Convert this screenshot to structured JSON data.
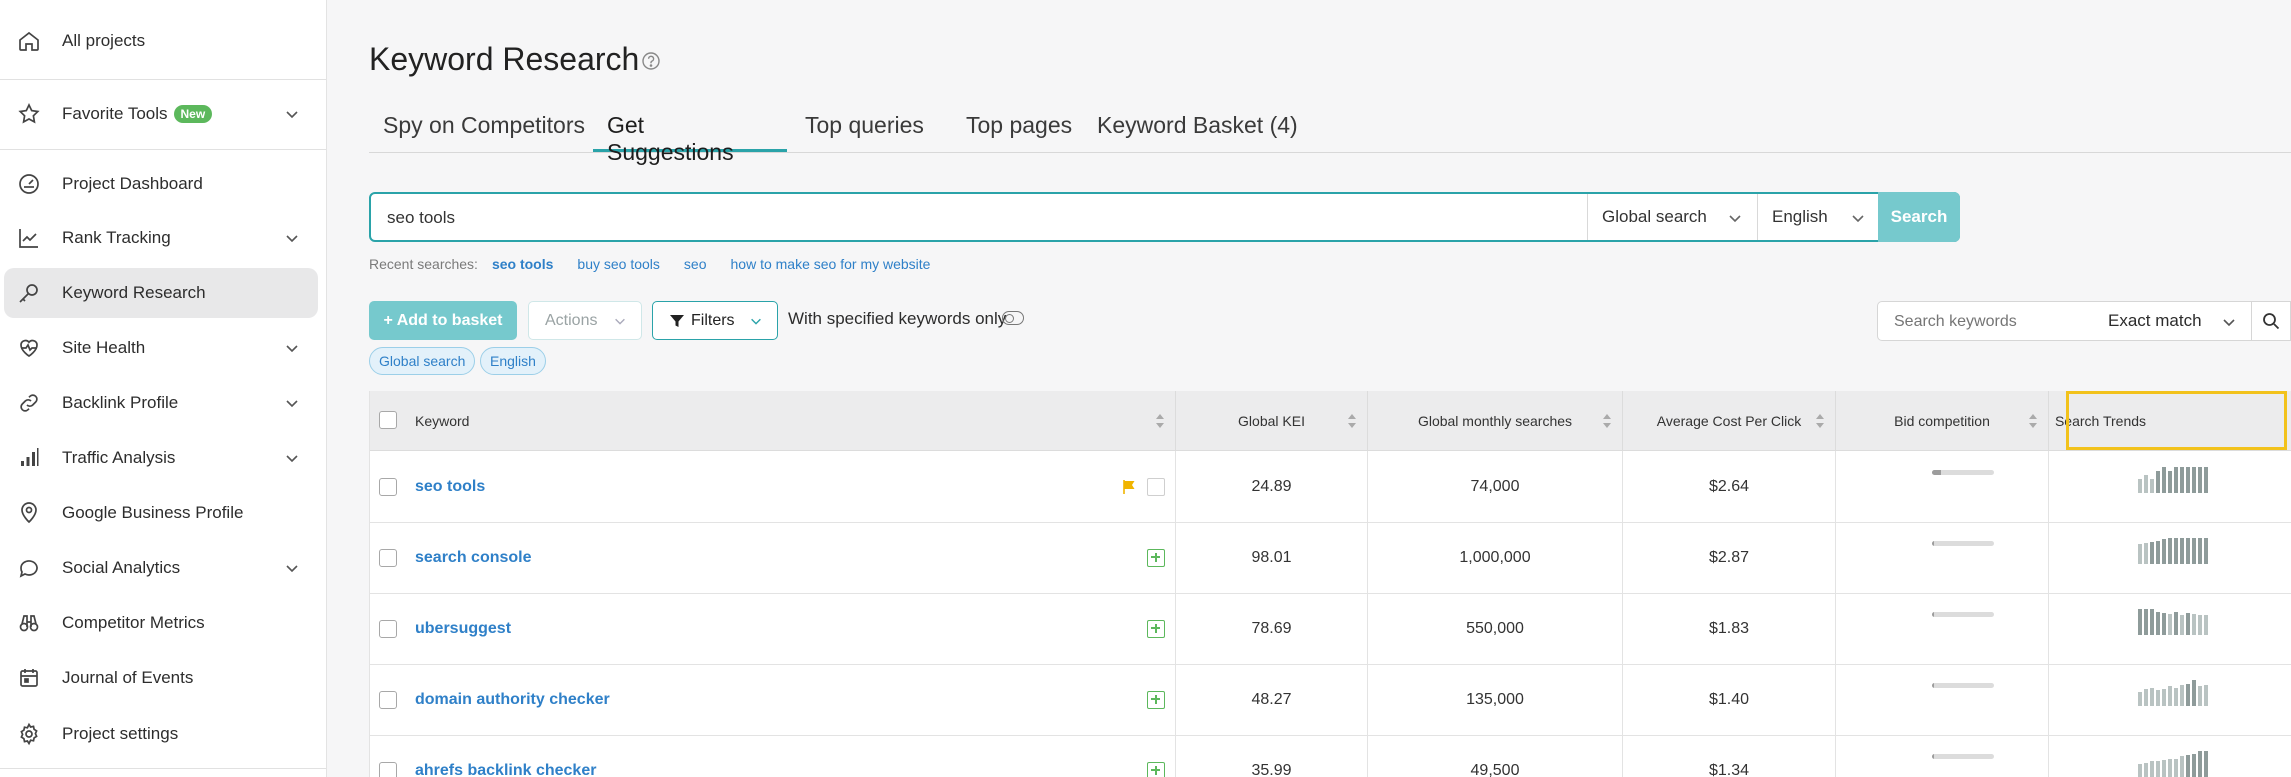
{
  "sidebar": {
    "items": [
      {
        "label": "All projects",
        "icon": "home-icon"
      },
      {
        "label": "Favorite Tools",
        "icon": "star-icon",
        "badge": "New"
      },
      {
        "label": "Project Dashboard",
        "icon": "dashboard-icon"
      },
      {
        "label": "Rank Tracking",
        "icon": "chart-line-icon"
      },
      {
        "label": "Keyword Research",
        "icon": "key-icon"
      },
      {
        "label": "Site Health",
        "icon": "heart-pulse-icon"
      },
      {
        "label": "Backlink Profile",
        "icon": "link-icon"
      },
      {
        "label": "Traffic Analysis",
        "icon": "bars-icon"
      },
      {
        "label": "Google Business Profile",
        "icon": "location-pin-icon"
      },
      {
        "label": "Social Analytics",
        "icon": "chat-bubble-icon"
      },
      {
        "label": "Competitor Metrics",
        "icon": "binoculars-icon"
      },
      {
        "label": "Journal of Events",
        "icon": "calendar-icon"
      },
      {
        "label": "Project settings",
        "icon": "gear-icon"
      }
    ]
  },
  "page": {
    "title": "Keyword Research",
    "tabs": [
      "Spy on Competitors",
      "Get Suggestions",
      "Top queries",
      "Top pages",
      "Keyword Basket (4)"
    ],
    "active_tab": "Get Suggestions"
  },
  "search": {
    "value": "seo tools",
    "location": "Global search",
    "language": "English",
    "button": "Search"
  },
  "recent": {
    "label": "Recent searches:",
    "items": [
      "seo tools",
      "buy seo tools",
      "seo",
      "how to make seo for my website"
    ]
  },
  "toolbar": {
    "add_to_basket": "+ Add to basket",
    "actions": "Actions",
    "filters": "Filters",
    "specified_only": "With specified keywords only",
    "kw_search_placeholder": "Search keywords",
    "match": "Exact match"
  },
  "chips": [
    "Global search",
    "English"
  ],
  "table": {
    "columns": [
      "Keyword",
      "Global KEI",
      "Global monthly searches",
      "Average Cost Per Click",
      "Bid competition",
      "Search Trends"
    ],
    "rows": [
      {
        "keyword": "seo tools",
        "kei": "24.89",
        "searches": "74,000",
        "cpc": "$2.64",
        "bid": 0.14,
        "flagged": true,
        "trend": [
          0.55,
          0.7,
          0.55,
          0.85,
          1,
          0.85,
          1,
          1,
          1,
          1,
          1,
          1
        ]
      },
      {
        "keyword": "search console",
        "kei": "98.01",
        "searches": "1,000,000",
        "cpc": "$2.87",
        "bid": 0.03,
        "flagged": false,
        "trend": [
          0.75,
          0.8,
          0.85,
          0.9,
          0.95,
          1,
          1,
          1,
          1,
          1,
          1,
          1
        ]
      },
      {
        "keyword": "ubersuggest",
        "kei": "78.69",
        "searches": "550,000",
        "cpc": "$1.83",
        "bid": 0.03,
        "flagged": false,
        "trend": [
          1,
          1,
          1,
          0.9,
          0.85,
          0.8,
          0.9,
          0.75,
          0.85,
          0.8,
          0.75,
          0.75
        ]
      },
      {
        "keyword": "domain authority checker",
        "kei": "48.27",
        "searches": "135,000",
        "cpc": "$1.40",
        "bid": 0.03,
        "flagged": false,
        "trend": [
          0.55,
          0.65,
          0.7,
          0.6,
          0.65,
          0.75,
          0.7,
          0.8,
          0.85,
          1,
          0.75,
          0.8
        ]
      },
      {
        "keyword": "ahrefs backlink checker",
        "kei": "35.99",
        "searches": "49,500",
        "cpc": "$1.34",
        "bid": 0.03,
        "flagged": false,
        "trend": [
          0.5,
          0.55,
          0.6,
          0.6,
          0.65,
          0.7,
          0.7,
          0.8,
          0.85,
          0.9,
          1,
          1
        ]
      }
    ]
  },
  "colors": {
    "accent": "#2aa3a9",
    "link": "#2f80c8",
    "highlight": "#f2c21b",
    "badge": "#5cb85c"
  }
}
